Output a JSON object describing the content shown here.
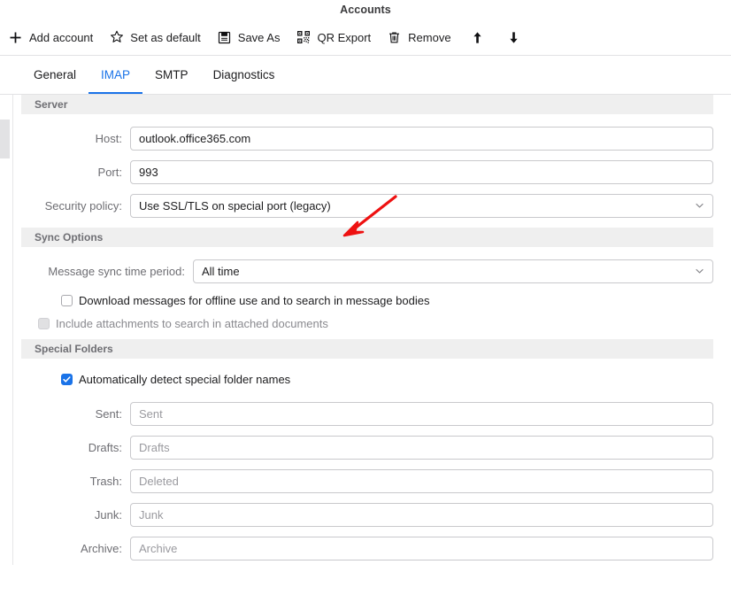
{
  "window": {
    "title": "Accounts"
  },
  "toolbar": {
    "items": [
      {
        "label": "Add account",
        "icon": "plus-icon"
      },
      {
        "label": "Set as default",
        "icon": "star-icon"
      },
      {
        "label": "Save As",
        "icon": "floppy-disk-icon"
      },
      {
        "label": "QR Export",
        "icon": "qr-code-icon"
      },
      {
        "label": "Remove",
        "icon": "trash-icon"
      }
    ],
    "move_up_icon": "arrow-up-icon",
    "move_down_icon": "arrow-down-icon"
  },
  "tabs": [
    {
      "label": "General",
      "active": false
    },
    {
      "label": "IMAP",
      "active": true
    },
    {
      "label": "SMTP",
      "active": false
    },
    {
      "label": "Diagnostics",
      "active": false
    }
  ],
  "sections": {
    "server": {
      "title": "Server",
      "host": {
        "label": "Host:",
        "value": "outlook.office365.com"
      },
      "port": {
        "label": "Port:",
        "value": "993"
      },
      "security": {
        "label": "Security policy:",
        "value": "Use SSL/TLS on special port (legacy)",
        "chevron_icon": "chevron-down-icon"
      }
    },
    "sync": {
      "title": "Sync Options",
      "period": {
        "label": "Message sync time period:",
        "value": "All time",
        "chevron_icon": "chevron-down-icon"
      },
      "download_offline": {
        "label": "Download messages for offline use and to search in message bodies",
        "checked": false,
        "disabled": false
      },
      "include_attachments": {
        "label": "Include attachments to search in attached documents",
        "checked": false,
        "disabled": true
      }
    },
    "special_folders": {
      "title": "Special Folders",
      "auto_detect": {
        "label": "Automatically detect special folder names",
        "checked": true
      },
      "folders": [
        {
          "label": "Sent:",
          "value": "Sent"
        },
        {
          "label": "Drafts:",
          "value": "Drafts"
        },
        {
          "label": "Trash:",
          "value": "Deleted"
        },
        {
          "label": "Junk:",
          "value": "Junk"
        },
        {
          "label": "Archive:",
          "value": "Archive"
        }
      ]
    }
  },
  "annotation": {
    "type": "arrow",
    "color": "#ee1111",
    "points_at": "security-policy-select"
  },
  "colors": {
    "accent": "#1a73e8",
    "section_header_bg": "#efefef",
    "label_gray": "#6e6e73",
    "annotation_red": "#ee1111"
  }
}
